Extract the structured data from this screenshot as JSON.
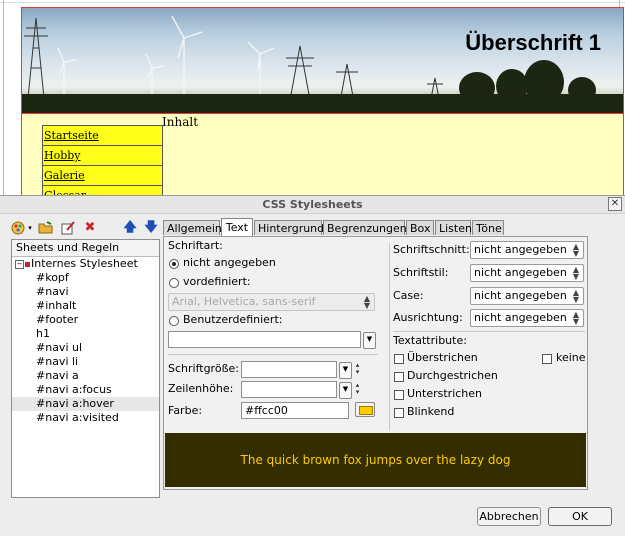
{
  "preview": {
    "banner_title": "Überschrift 1",
    "content_label": "Inhalt",
    "nav_links": [
      "Startseite",
      "Hobby",
      "Galerie",
      "Glossar"
    ]
  },
  "dialog": {
    "title": "CSS Stylesheets",
    "close_glyph": "✕",
    "tree": {
      "header": "Sheets und Regeln",
      "root_label": "Internes Stylesheet",
      "items": [
        "#kopf",
        "#navi",
        "#inhalt",
        "#footer",
        "h1",
        "#navi ul",
        "#navi li",
        "#navi a",
        "#navi a:focus",
        "#navi a:hover",
        "#navi a:visited"
      ],
      "selected_item": "#navi a:hover"
    },
    "toolbar_icons": [
      "palette-icon",
      "open-folder-icon",
      "edit-icon",
      "delete-icon",
      "arrow-up-icon",
      "arrow-down-icon"
    ],
    "tabs": [
      "Allgemein",
      "Text",
      "Hintergrund",
      "Begrenzungen",
      "Box",
      "Listen",
      "Töne"
    ],
    "active_tab": "Text",
    "text_tab": {
      "schriftart_label": "Schriftart:",
      "radio_not_specified": "nicht angegeben",
      "radio_predefined": "vordefiniert:",
      "predefined_value": "Arial, Helvetica, sans-serif",
      "radio_custom": "Benutzerdefiniert:",
      "custom_value": "",
      "font_size_label": "Schriftgröße:",
      "font_size_value": "",
      "line_height_label": "Zeilenhöhe:",
      "line_height_value": "",
      "color_label": "Farbe:",
      "color_value": "#ffcc00",
      "schriftschnitt_label": "Schriftschnitt:",
      "schriftschnitt_value": "nicht angegeben",
      "schriftstil_label": "Schriftstil:",
      "schriftstil_value": "nicht angegeben",
      "case_label": "Case:",
      "case_value": "nicht angegeben",
      "ausrichtung_label": "Ausrichtung:",
      "ausrichtung_value": "nicht angegeben",
      "textattribute_label": "Textattribute:",
      "attr_overline": "Überstrichen",
      "attr_none": "keine",
      "attr_strikethrough": "Durchgestrichen",
      "attr_underline": "Unterstrichen",
      "attr_blink": "Blinkend",
      "sample_text": "The quick brown fox jumps over the lazy dog"
    },
    "buttons": {
      "cancel": "Abbrechen",
      "ok": "OK"
    }
  },
  "colors": {
    "sample_bg": "#332d00",
    "sample_fg": "#ffcc00",
    "content_bg": "#ffffc0",
    "nav_bg": "#ffff1a"
  }
}
